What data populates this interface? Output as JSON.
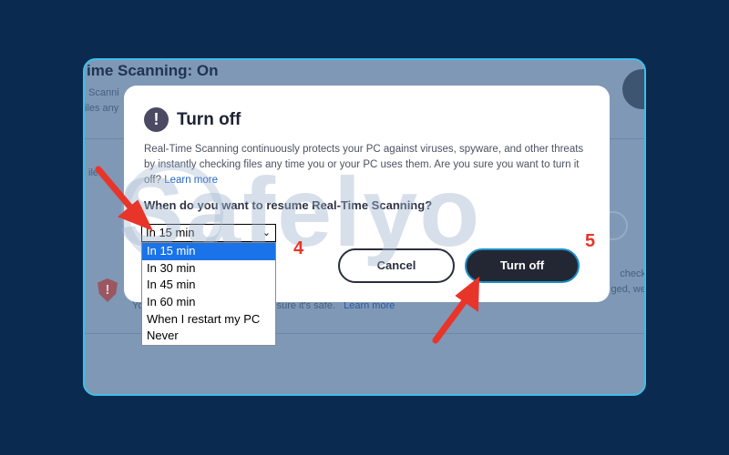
{
  "background": {
    "title": "ime Scanning: On",
    "subtitle_fragment": "Scanni",
    "subtitle_fragment2": "iles any",
    "left_fragment": "ile",
    "right_text_1": "check",
    "right_text_2": "ged, we",
    "note_text": "Yo                                              st. Add it back only if you are sure it's safe.",
    "note_link": "Learn more"
  },
  "dialog": {
    "icon": "exclamation-icon",
    "title": "Turn off",
    "body": "Real-Time Scanning continuously protects your PC against viruses, spyware, and other threats by instantly checking files any time you or your PC uses them. Are you sure you want to turn it off?",
    "body_link": "Learn more",
    "question": "When do you want to resume Real-Time Scanning?",
    "select": {
      "value": "In 15 min",
      "options": [
        "In 15 min",
        "In 30 min",
        "In 45 min",
        "In 60 min",
        "When I restart my PC",
        "Never"
      ],
      "selected_index": 0
    },
    "cancel_label": "Cancel",
    "turnoff_label": "Turn off"
  },
  "annotations": {
    "step_4": "4",
    "step_5": "5",
    "watermark": "Safelyo",
    "arrow_color": "#e8352a"
  },
  "colors": {
    "page_bg": "#0b2a4f",
    "window_border": "#3fbfe8",
    "primary_button": "#232733",
    "highlight": "#1a73e8"
  }
}
